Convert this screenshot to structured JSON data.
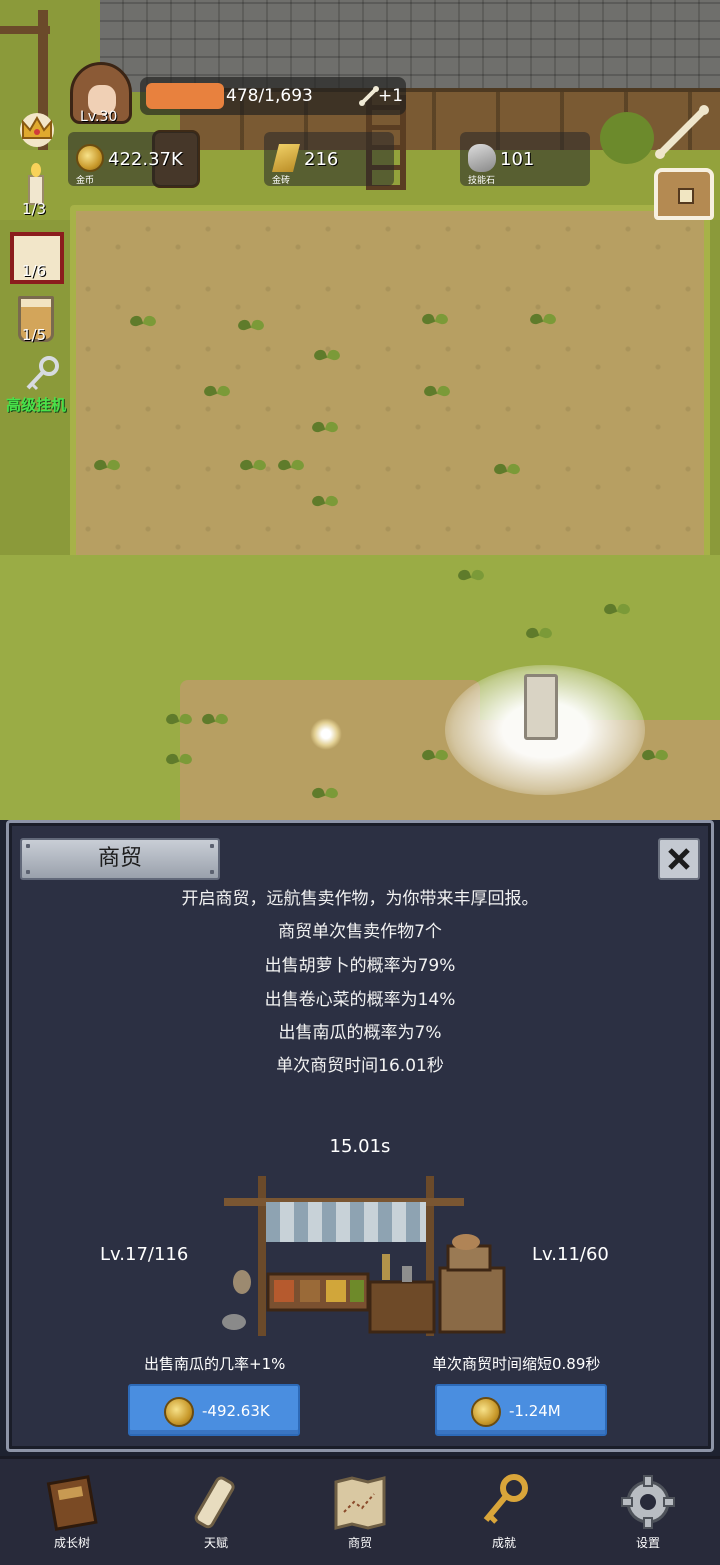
{
  "player": {
    "level": "Lv.30",
    "xp_text": "478/1,693",
    "xp_fraction": 0.283,
    "bone_bonus": "+1"
  },
  "resources": [
    {
      "name": "gold-coin",
      "amount": "422.37K",
      "label": "金币"
    },
    {
      "name": "gold-ingot",
      "amount": "216",
      "label": "金砖"
    },
    {
      "name": "skill-stone",
      "amount": "101",
      "label": "技能石"
    }
  ],
  "sidebar": {
    "candle_count": "1/3",
    "scroll_count": "1/6",
    "cup_count": "1/5",
    "auto_label": "高级挂机"
  },
  "trade": {
    "title": "商贸",
    "description": [
      "开启商贸，远航售卖作物，为你带来丰厚回报。",
      "商贸单次售卖作物7个",
      "出售胡萝卜的概率为79%",
      "出售卷心菜的概率为14%",
      "出售南瓜的概率为7%",
      "单次商贸时间16.01秒"
    ],
    "timer": "15.01s",
    "left": {
      "level": "Lv.17/116",
      "desc": "出售南瓜的几率+1%",
      "cost": "-492.63K"
    },
    "right": {
      "level": "Lv.11/60",
      "desc": "单次商贸时间缩短0.89秒",
      "cost": "-1.24M"
    }
  },
  "nav": [
    {
      "id": "growth-tree",
      "label": "成长树",
      "icon": "book-icon"
    },
    {
      "id": "talent",
      "label": "天赋",
      "icon": "scroll-icon"
    },
    {
      "id": "trade",
      "label": "商贸",
      "icon": "map-icon"
    },
    {
      "id": "achievement",
      "label": "成就",
      "icon": "key-icon"
    },
    {
      "id": "settings",
      "label": "设置",
      "icon": "gear-icon"
    }
  ],
  "colors": {
    "xp": "#e8813e",
    "panel_bg": "#2c3043",
    "button": "#4a8ee0",
    "auto_label": "#49e24a"
  }
}
